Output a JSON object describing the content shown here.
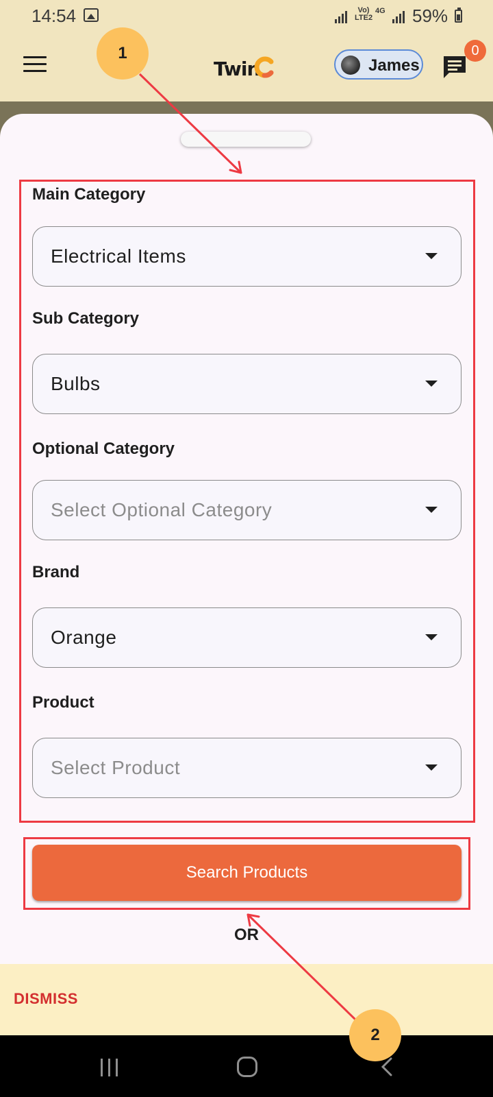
{
  "status_bar": {
    "time": "14:54",
    "network_volte": "Vo) LTE2",
    "network_type": "4G",
    "battery": "59%"
  },
  "app_bar": {
    "logo_text": "Twin",
    "user_name": "James",
    "notification_count": "0"
  },
  "form": {
    "fields": [
      {
        "label": "Main Category",
        "value": "Electrical Items",
        "is_placeholder": false
      },
      {
        "label": "Sub Category",
        "value": "Bulbs",
        "is_placeholder": false
      },
      {
        "label": "Optional Category",
        "value": "Select Optional Category",
        "is_placeholder": true
      },
      {
        "label": "Brand",
        "value": "Orange",
        "is_placeholder": false
      },
      {
        "label": "Product",
        "value": "Select Product",
        "is_placeholder": true
      }
    ],
    "search_button_label": "Search Products",
    "or_label": "OR"
  },
  "banner": {
    "dismiss_label": "DISMISS"
  },
  "annotations": {
    "badge_1": "1",
    "badge_2": "2"
  },
  "colors": {
    "accent": "#ec693d",
    "annotation_red": "#ed3a43",
    "annotation_badge": "#fcc15d",
    "app_bar": "#f1e5bf",
    "sheet": "#fcf6fb",
    "dismiss": "#d32f2f"
  }
}
